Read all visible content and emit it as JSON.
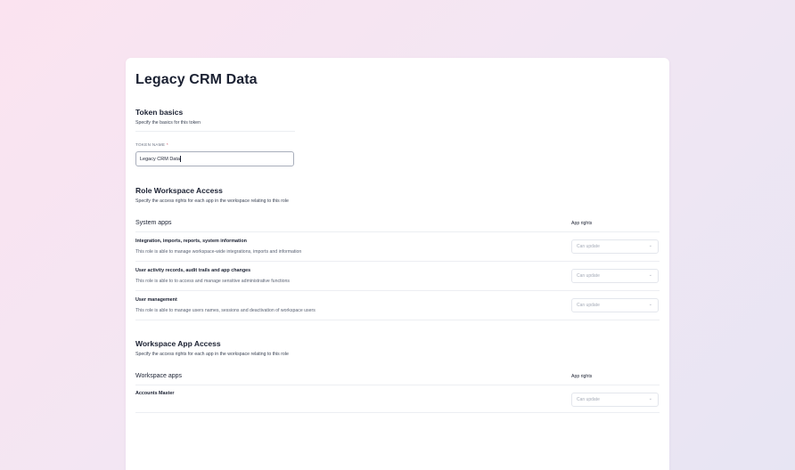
{
  "page": {
    "title": "Legacy CRM Data"
  },
  "token_basics": {
    "title": "Token basics",
    "subtitle": "Specify the basics for this token",
    "name_label": "TOKEN NAME",
    "required_mark": "*",
    "name_value": "Legacy CRM Data"
  },
  "role_access": {
    "title": "Role Workspace Access",
    "subtitle": "Specify the access rights for each app in the workspace relating to this role",
    "group_name": "System apps",
    "rights_header": "App rights",
    "rows": [
      {
        "name": "Integration, imports, reports, system information",
        "description": "This role is able to manage workspace-wide integrations, imports and information",
        "right": "Can update"
      },
      {
        "name": "User activity records, audit trails and app changes",
        "description": "This role is able to to access and manage sensitive administrative functions",
        "right": "Can update"
      },
      {
        "name": "User management",
        "description": "This role is able to manage users names, sessions and deactivation of workspace users",
        "right": "Can update"
      }
    ]
  },
  "workspace_access": {
    "title": "Workspace App Access",
    "subtitle": "Specify the access rights for each app in the workspace relating to this role",
    "group_name": "Workspace apps",
    "rights_header": "App rights",
    "rows": [
      {
        "name": "Accounts Master",
        "right": "Can update"
      }
    ]
  },
  "icons": {
    "select_chevron": "chevron-down-icon"
  }
}
